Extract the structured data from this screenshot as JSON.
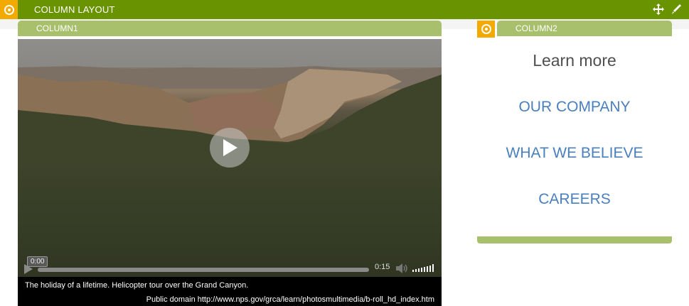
{
  "layout_bar": {
    "title": "COLUMN LAYOUT"
  },
  "column1": {
    "header": "COLUMN1",
    "video": {
      "current_time": "0:00",
      "duration": "0:15",
      "caption": "The holiday of a lifetime. Helicopter tour over the Grand Canyon.",
      "credit": "Public domain http://www.nps.gov/grca/learn/photosmultimedia/b-roll_hd_index.htm",
      "progress": 0.0
    }
  },
  "column2": {
    "header": "COLUMN2",
    "heading": "Learn more",
    "links": [
      "OUR COMPANY",
      "WHAT WE BELIEVE",
      "CAREERS"
    ]
  },
  "colors": {
    "layout_bar": "#6a9300",
    "column_header": "#a8bf6b",
    "handle": "#f2a900",
    "link": "#4a7fbd"
  },
  "icons": [
    "target-icon",
    "move-icon",
    "edit-icon",
    "play-icon",
    "volume-icon"
  ]
}
